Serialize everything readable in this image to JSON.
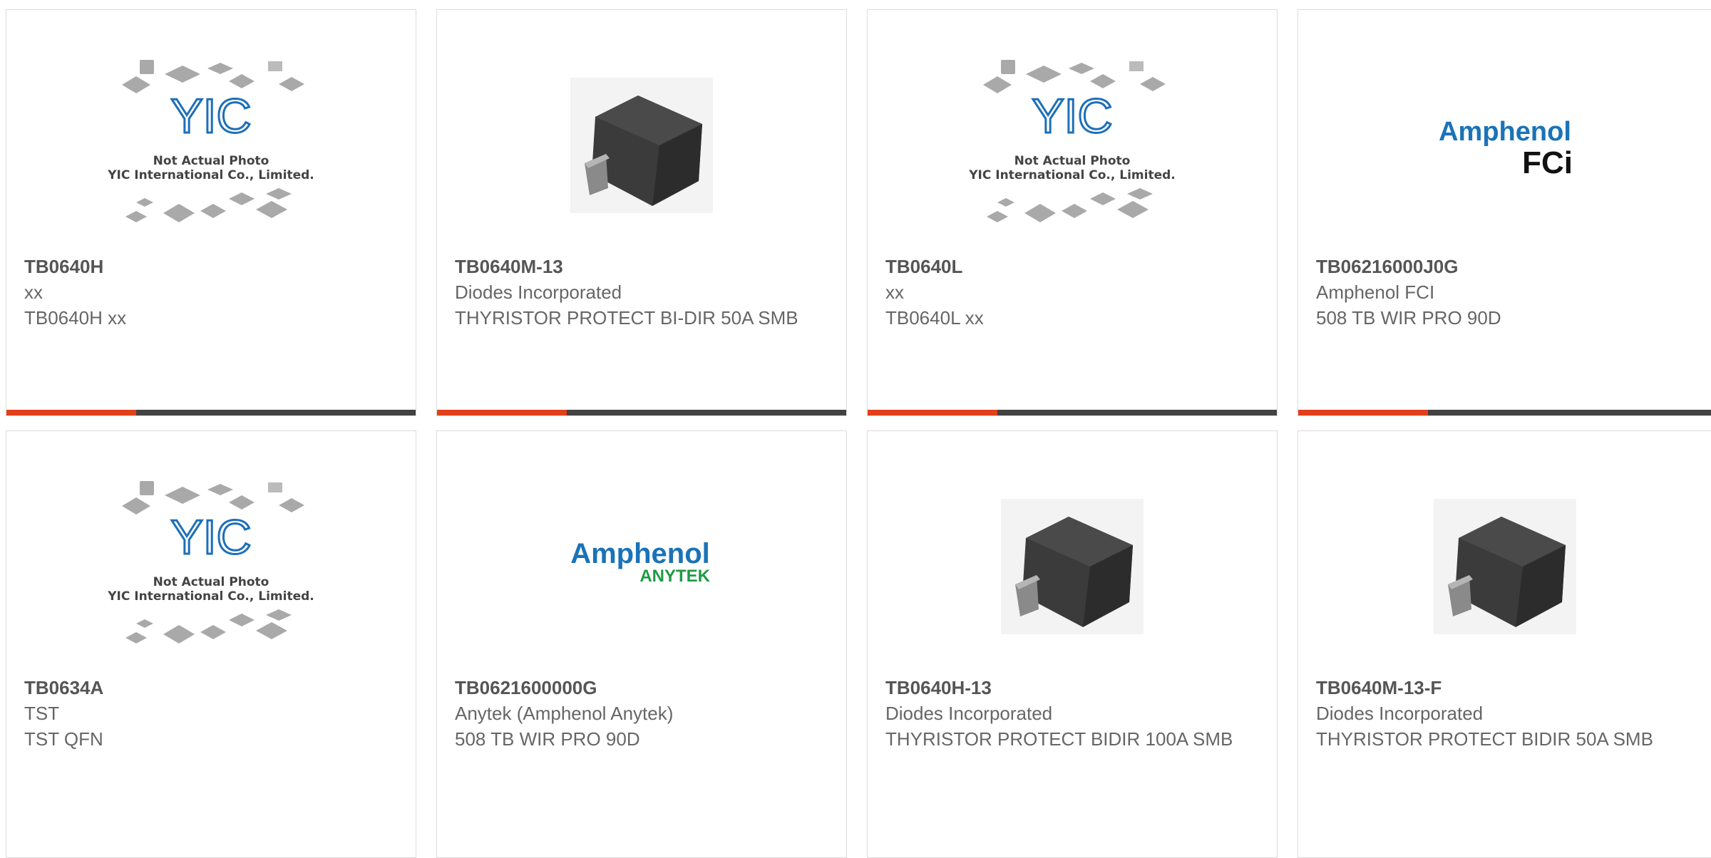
{
  "products": [
    {
      "part_number": "TB0640H",
      "manufacturer": "xx",
      "description": "TB0640H xx",
      "image": "not-actual-photo"
    },
    {
      "part_number": "TB0640M-13",
      "manufacturer": "Diodes Incorporated",
      "description": "THYRISTOR PROTECT BI-DIR 50A SMB",
      "image": "smb-package"
    },
    {
      "part_number": "TB0640L",
      "manufacturer": "xx",
      "description": "TB0640L xx",
      "image": "not-actual-photo"
    },
    {
      "part_number": "TB06216000J0G",
      "manufacturer": "Amphenol FCI",
      "description": "508 TB WIR PRO 90D",
      "image": "amphenol-fci-logo"
    },
    {
      "part_number": "TB0634A",
      "manufacturer": "TST",
      "description": "TST QFN",
      "image": "not-actual-photo"
    },
    {
      "part_number": "TB0621600000G",
      "manufacturer": "Anytek (Amphenol Anytek)",
      "description": "508 TB WIR PRO 90D",
      "image": "amphenol-anytek-logo"
    },
    {
      "part_number": "TB0640H-13",
      "manufacturer": "Diodes Incorporated",
      "description": "THYRISTOR PROTECT BIDIR 100A SMB",
      "image": "smb-package"
    },
    {
      "part_number": "TB0640M-13-F",
      "manufacturer": "Diodes Incorporated",
      "description": "THYRISTOR PROTECT BIDIR 50A SMB",
      "image": "smb-package"
    }
  ],
  "placeholder": {
    "logo_text": "YIC",
    "line1": "Not Actual Photo",
    "line2": "YIC International Co., Limited."
  },
  "logos": {
    "fci": {
      "brand": "Amphenol",
      "sub": "FCi"
    },
    "anytek": {
      "brand": "Amphenol",
      "sub": "ANYTEK"
    }
  },
  "colors": {
    "accent": "#e2401b",
    "bar": "#424242",
    "brand_blue": "#1a73b8",
    "anytek_green": "#1e9a45"
  }
}
